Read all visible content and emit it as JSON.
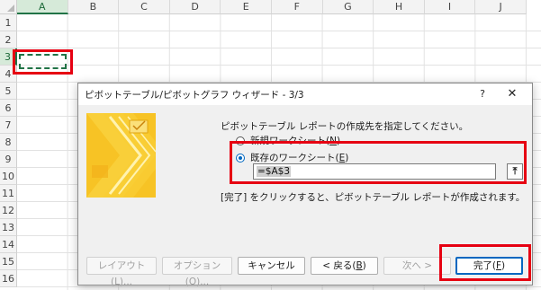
{
  "sheet": {
    "columns": [
      "A",
      "B",
      "C",
      "D",
      "E",
      "F",
      "G",
      "H",
      "I",
      "J"
    ],
    "rows": [
      "1",
      "2",
      "3",
      "4",
      "5",
      "6",
      "7",
      "8",
      "9",
      "10",
      "11",
      "12",
      "13",
      "14",
      "15",
      "16"
    ],
    "selected_column": "A",
    "selected_row": "3",
    "accent_color": "#217346"
  },
  "highlight_color": "#e60012",
  "dialog": {
    "title": "ピボットテーブル/ピボットグラフ ウィザード - 3/3",
    "help_label": "?",
    "close_label": "✕",
    "image_icon": "wizard-chevron-image",
    "prompt": "ピボットテーブル レポートの作成先を指定してください。",
    "option_new": {
      "label": "新規ワークシート(",
      "key": "N",
      "end": ")",
      "selected": false
    },
    "option_existing": {
      "label": "既存のワークシート(",
      "key": "E",
      "end": ")",
      "selected": true
    },
    "reference_value": "=$A$3",
    "collapse_icon": "collapse-dialog-icon",
    "info": "[完了] をクリックすると、ピボットテーブル レポートが作成されます。",
    "buttons": {
      "layout": "レイアウト(L)...",
      "options": "オプション(O)...",
      "cancel": "キャンセル",
      "back_label": "< 戻る(",
      "back_key": "B",
      "back_end": ")",
      "next": "次へ >",
      "finish_label": "完了(",
      "finish_key": "F",
      "finish_end": ")"
    }
  }
}
